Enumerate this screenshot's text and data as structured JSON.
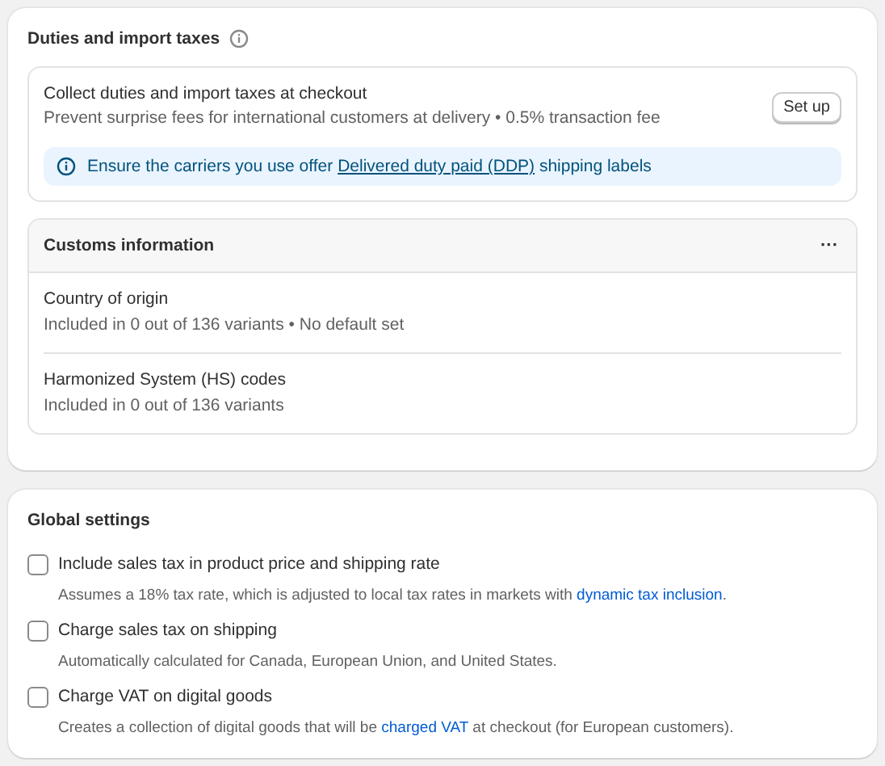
{
  "duties": {
    "title": "Duties and import taxes",
    "collect": {
      "title": "Collect duties and import taxes at checkout",
      "description": "Prevent surprise fees for international customers at delivery • 0.5% transaction fee",
      "button": "Set up"
    },
    "banner": {
      "before": "Ensure the carriers you use offer ",
      "link": "Delivered duty paid (DDP)",
      "after": " shipping labels"
    },
    "customs": {
      "title": "Customs information",
      "menu": "···",
      "rows": [
        {
          "title": "Country of origin",
          "description": "Included in 0 out of 136 variants • No default set"
        },
        {
          "title": "Harmonized System (HS) codes",
          "description": "Included in 0 out of 136 variants"
        }
      ]
    }
  },
  "global_settings": {
    "title": "Global settings",
    "options": [
      {
        "label": "Include sales tax in product price and shipping rate",
        "checked": false,
        "before": "Assumes a 18% tax rate, which is adjusted to local tax rates in markets with ",
        "link": "dynamic tax inclusion",
        "after": "."
      },
      {
        "label": "Charge sales tax on shipping",
        "checked": false,
        "before": "Automatically calculated for Canada, European Union, and United States."
      },
      {
        "label": "Charge VAT on digital goods",
        "checked": false,
        "before": "Creates a collection of digital goods that will be ",
        "link": "charged VAT",
        "after": " at checkout (for European customers)."
      }
    ]
  }
}
